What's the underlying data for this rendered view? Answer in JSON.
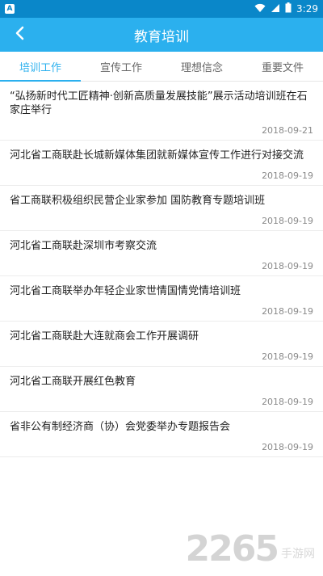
{
  "statusbar": {
    "app_badge": "A",
    "time": "3:29"
  },
  "header": {
    "title": "教育培训"
  },
  "tabs": [
    {
      "label": "培训工作"
    },
    {
      "label": "宣传工作"
    },
    {
      "label": "理想信念"
    },
    {
      "label": "重要文件"
    }
  ],
  "items": [
    {
      "title": "“弘扬新时代工匠精神·创新高质量发展技能”展示活动培训班在石家庄举行",
      "date": "2018-09-21"
    },
    {
      "title": "河北省工商联赴长城新媒体集团就新媒体宣传工作进行对接交流",
      "date": "2018-09-19"
    },
    {
      "title": "省工商联积极组织民营企业家参加 国防教育专题培训班",
      "date": "2018-09-19"
    },
    {
      "title": "河北省工商联赴深圳市考察交流",
      "date": "2018-09-19"
    },
    {
      "title": "河北省工商联举办年轻企业家世情国情党情培训班",
      "date": "2018-09-19"
    },
    {
      "title": "河北省工商联赴大连就商会工作开展调研",
      "date": "2018-09-19"
    },
    {
      "title": "河北省工商联开展红色教育",
      "date": "2018-09-19"
    },
    {
      "title": "省非公有制经济商（协）会党委举办专题报告会",
      "date": "2018-09-19"
    }
  ],
  "watermark": {
    "number": "2265",
    "text": "手游网"
  },
  "colors": {
    "status_bar": "#0a87c9",
    "title_bar": "#2bb0ee",
    "tab_active": "#2bb0ee"
  }
}
